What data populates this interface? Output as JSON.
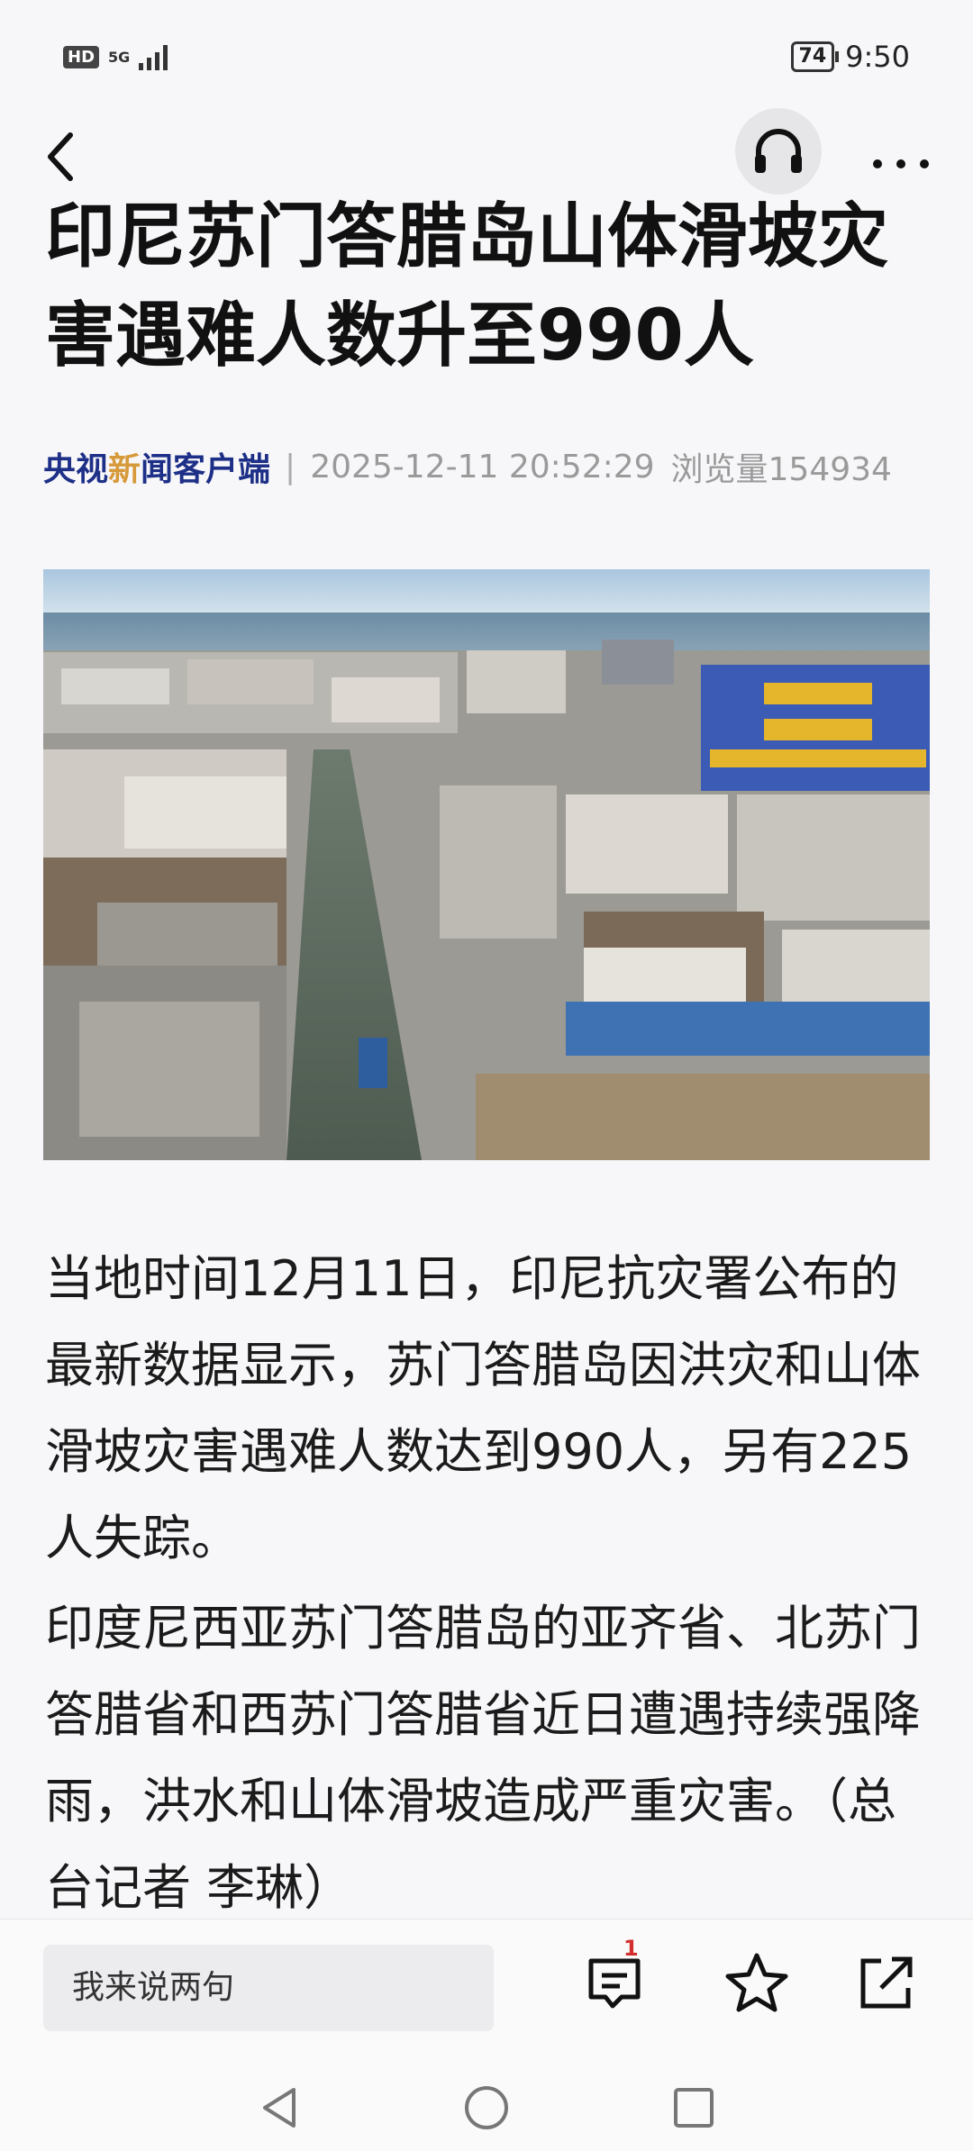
{
  "status_bar": {
    "hd_label": "HD",
    "network": "5G",
    "battery": "74",
    "time": "9:50"
  },
  "nav": {
    "back_icon": "chevron-left-icon",
    "listen_icon": "headphones-icon",
    "more_icon": "more-icon"
  },
  "article": {
    "title": "印尼苏门答腊岛山体滑坡灾害遇难人数升至990人",
    "source_prefix": "央视",
    "source_highlight": "新",
    "source_suffix": "闻客户端",
    "separator": "|",
    "datetime": "2025-12-11 20:52:29",
    "views": "浏览量154934",
    "paragraphs": [
      "当地时间12月11日，印尼抗灾署公布的最新数据显示，苏门答腊岛因洪灾和山体滑坡灾害遇难人数达到990人，另有225人失踪。",
      "印度尼西亚苏门答腊岛的亚齐省、北苏门答腊省和西苏门答腊省近日遭遇持续强降雨，洪水和山体滑坡造成严重灾害。（总台记者 李琳）"
    ]
  },
  "bottom_bar": {
    "comment_placeholder": "我来说两句",
    "comment_count": "1"
  },
  "colors": {
    "source_blue": "#1d2f87",
    "source_accent": "#d79a3b",
    "badge_red": "#d32f2f"
  }
}
